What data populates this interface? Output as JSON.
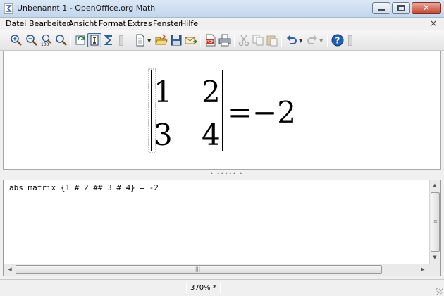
{
  "window": {
    "title": "Unbenannt 1 - OpenOffice.org Math",
    "minimize_glyph": "",
    "close_glyph": "✕"
  },
  "menubar": {
    "items": [
      {
        "key": "D",
        "rest": "atei"
      },
      {
        "key": "B",
        "rest": "earbeiten"
      },
      {
        "key": "A",
        "rest": "nsicht"
      },
      {
        "key": "F",
        "rest": "ormat"
      },
      {
        "pre": "E",
        "key": "x",
        "rest": "tras"
      },
      {
        "pre": "Fe",
        "key": "n",
        "rest": "ster"
      },
      {
        "key": "H",
        "rest": "ilfe"
      }
    ],
    "close_glyph": "×"
  },
  "toolbar": {
    "icons": [
      "zoom-in-icon",
      "zoom-out-icon",
      "zoom-100-icon",
      "zoom-fit-icon",
      "update-icon",
      "formula-cursor-icon",
      "symbols-icon",
      "new-icon",
      "open-icon",
      "save-icon",
      "email-icon",
      "export-pdf-icon",
      "print-icon",
      "cut-icon",
      "copy-icon",
      "paste-icon",
      "undo-icon",
      "redo-icon",
      "help-icon"
    ],
    "zoom_100_label": "100",
    "active_tool": "formula-cursor"
  },
  "formula": {
    "source": "abs matrix {1 # 2 ## 3 # 4} = -2",
    "matrix": [
      [
        "1",
        "2"
      ],
      [
        "3",
        "4"
      ]
    ],
    "relation": "=",
    "result": "−2"
  },
  "command_window": {
    "text": "abs matrix {1 # 2 ## 3 # 4} = -2"
  },
  "statusbar": {
    "zoom": "370%",
    "modified": "*"
  },
  "colors": {
    "accent": "#3a6ea5",
    "close_red": "#c7432a",
    "help_blue": "#1e5fb4"
  }
}
